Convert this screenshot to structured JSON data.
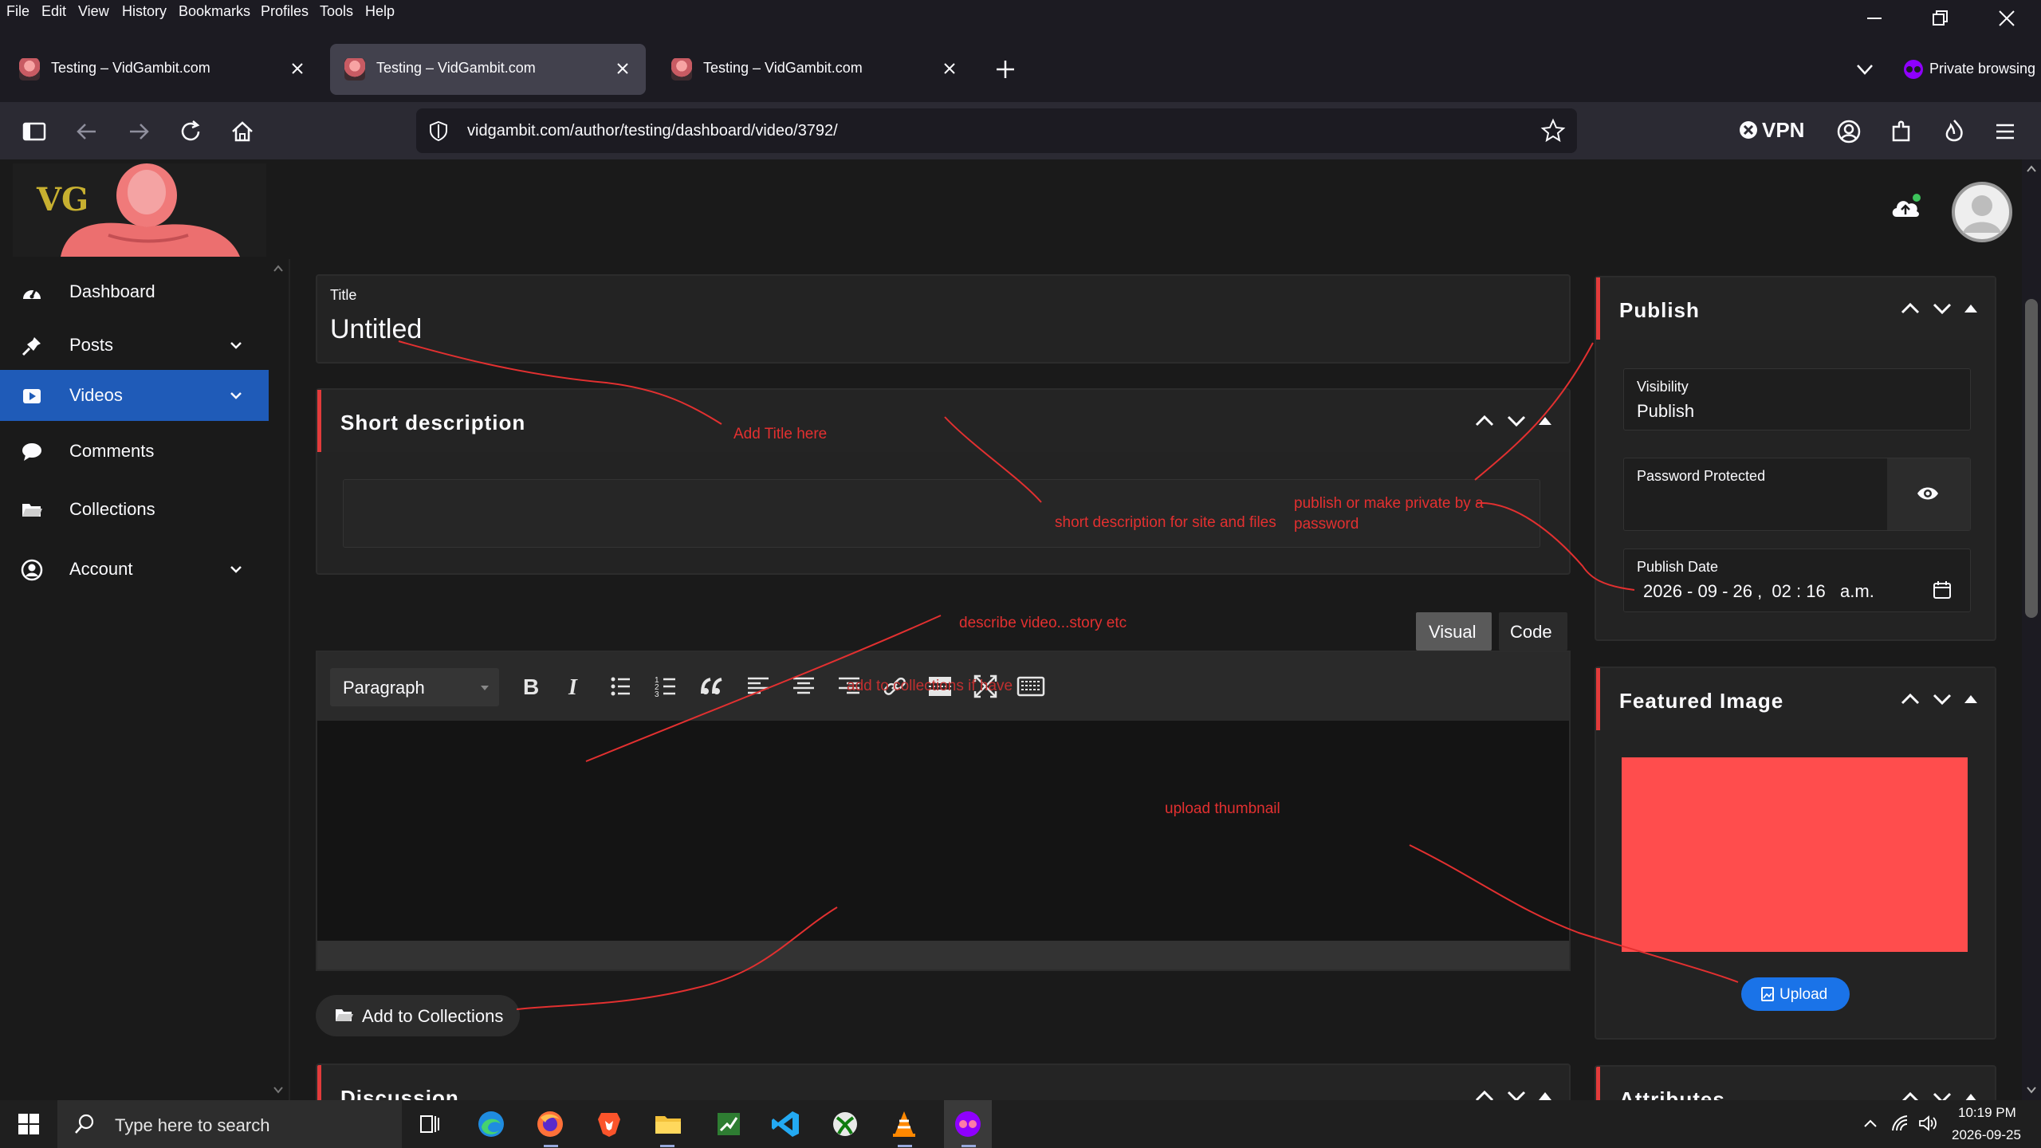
{
  "menu": [
    "File",
    "Edit",
    "View",
    "History",
    "Bookmarks",
    "Profiles",
    "Tools",
    "Help"
  ],
  "tabs": [
    {
      "title": "Testing – VidGambit.com"
    },
    {
      "title": "Testing – VidGambit.com"
    },
    {
      "title": "Testing – VidGambit.com"
    }
  ],
  "private_browsing": "Private browsing",
  "url": "vidgambit.com/author/testing/dashboard/video/3792/",
  "vpn_label": "VPN",
  "logo_letters": "VG",
  "sidebar": {
    "items": [
      {
        "label": "Dashboard",
        "icon": "dashboard-icon"
      },
      {
        "label": "Posts",
        "icon": "pin-icon"
      },
      {
        "label": "Videos",
        "icon": "video-icon"
      },
      {
        "label": "Comments",
        "icon": "comment-icon"
      },
      {
        "label": "Collections",
        "icon": "folder-icon"
      },
      {
        "label": "Account",
        "icon": "user-circle-icon"
      }
    ]
  },
  "editor": {
    "title_label": "Title",
    "title_value": "Untitled",
    "short_description_heading": "Short description",
    "tab_visual": "Visual",
    "tab_code": "Code",
    "paragraph_select": "Paragraph",
    "add_to_collections": "Add to Collections",
    "discussion_heading": "Discussion"
  },
  "publish": {
    "heading": "Publish",
    "visibility_label": "Visibility",
    "visibility_value": "Publish",
    "password_label": "Password Protected",
    "date_label": "Publish Date",
    "date_value": "2026 - 09 - 26 ,  02 : 16   a.m."
  },
  "featured_image": {
    "heading": "Featured Image",
    "upload_label": "Upload"
  },
  "attributes_heading": "Attributes",
  "annotations": {
    "title": "Add Title here",
    "short_desc": "short description for site and files",
    "publish": "publish or make private by a password",
    "describe": "describe video...story etc",
    "collections": "add to collections if have",
    "thumbnail": "upload thumbnail"
  },
  "taskbar": {
    "search_placeholder": "Type here to search",
    "time": "10:19 PM",
    "date": "2026-09-25"
  },
  "colors": {
    "accent_blue": "#1f5bb8",
    "annotation_red": "#e23030",
    "thumbnail_red": "#ff4d4d",
    "upload_blue": "#1a73e8"
  }
}
